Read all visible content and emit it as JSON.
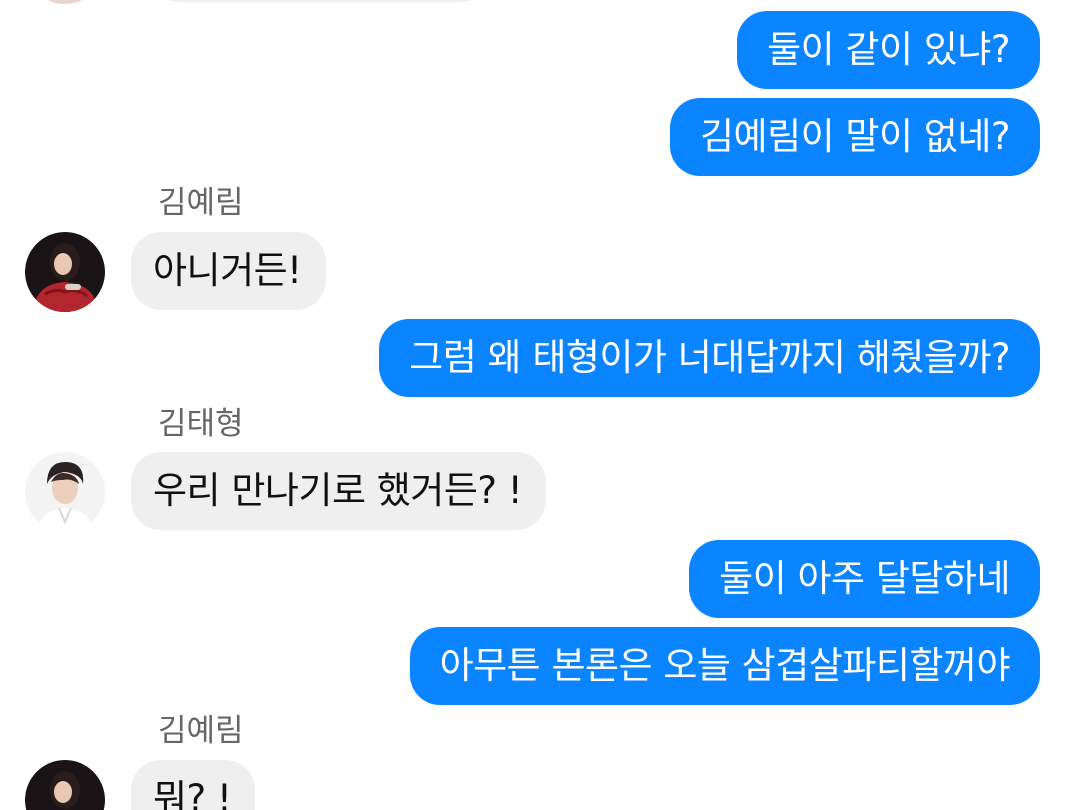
{
  "messages": {
    "m1": "둘이 같이 있냐?",
    "m2": "김예림이 말이 없네?",
    "m3_sender": "김예림",
    "m3": "아니거든!",
    "m4": "그럼 왜 태형이가 너대답까지 해줬을까?",
    "m5_sender": "김태형",
    "m5": "우리 만나기로 했거든? !",
    "m6": "둘이 아주 달달하네",
    "m7": "아무튼 본론은 오늘 삼겹살파티할꺼야",
    "m8_sender": "김예림",
    "m8": "뭐? !"
  },
  "colors": {
    "outgoing_bubble": "#0a84ff",
    "incoming_bubble": "#efefef",
    "sender_name": "#666666"
  },
  "icons": {
    "avatar_yerim": "avatar-red-sweater",
    "avatar_taehyung": "avatar-white-shirt"
  }
}
